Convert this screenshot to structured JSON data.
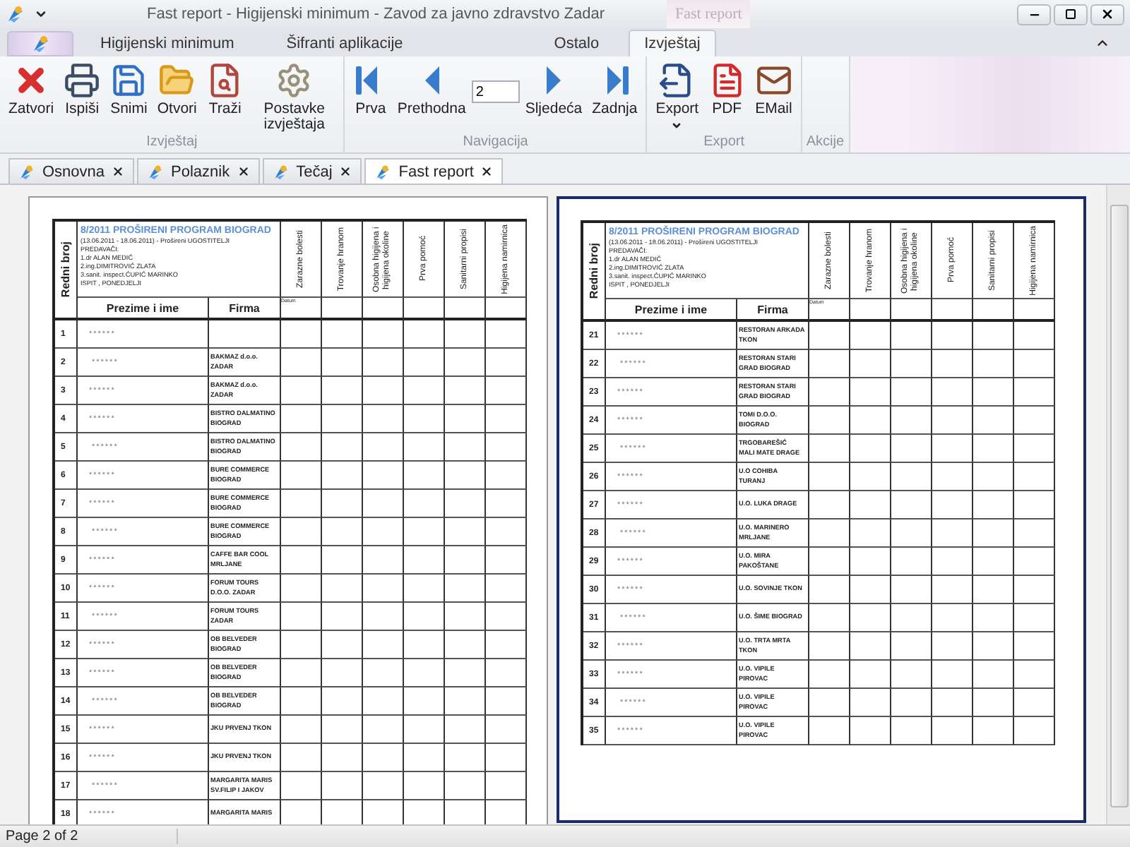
{
  "window": {
    "title": "Fast report - Higijenski minimum - Zavod za javno zdravstvo Zadar",
    "contextual_tab": "Fast report"
  },
  "ribbon": {
    "tabs": [
      {
        "label": "Higijenski minimum",
        "selected": false
      },
      {
        "label": "Šifranti aplikacije",
        "selected": false
      },
      {
        "label": "Ostalo",
        "selected": false
      },
      {
        "label": "Izvještaj",
        "selected": true
      }
    ],
    "groups": [
      {
        "label": "Izvještaj",
        "items": [
          {
            "kind": "close",
            "label": "Zatvori"
          },
          {
            "kind": "print",
            "label": "Ispiši"
          },
          {
            "kind": "save",
            "label": "Snimi"
          },
          {
            "kind": "open",
            "label": "Otvori"
          },
          {
            "kind": "find",
            "label": "Traži"
          },
          {
            "kind": "settings",
            "label": "Postavke izvještaja"
          }
        ]
      },
      {
        "label": "Navigacija",
        "items": [
          {
            "kind": "first",
            "label": "Prva"
          },
          {
            "kind": "previous",
            "label": "Prethodna"
          },
          {
            "kind": "page-field",
            "value": "2"
          },
          {
            "kind": "next",
            "label": "Sljedeća"
          },
          {
            "kind": "last",
            "label": "Zadnja"
          }
        ]
      },
      {
        "label": "Export",
        "items": [
          {
            "kind": "export",
            "label": "Export"
          },
          {
            "kind": "pdf",
            "label": "PDF"
          },
          {
            "kind": "email",
            "label": "EMail"
          }
        ]
      },
      {
        "label": "Akcije"
      }
    ]
  },
  "document_tabs": [
    {
      "label": "Osnovna",
      "selected": false
    },
    {
      "label": "Polaznik",
      "selected": false
    },
    {
      "label": "Tečaj",
      "selected": false
    },
    {
      "label": "Fast report",
      "selected": true
    }
  ],
  "pages": [
    {
      "selected": false,
      "header": {
        "index_header": "Redni broj",
        "title": "8/2011 PROŠIRENI PROGRAM BIOGRAD",
        "period": "(13.06.2011 - 18.06.2011) - Prošireni UGOSTITELJI",
        "lines": [
          "PREDAVAČI:",
          "1.dr ALAN MEDIĆ",
          "2.ing.DIMITROVIĆ ZLATA",
          "3.sanit. inspect.ĆUPIĆ MARINKO",
          "ISPIT , PONEDJELJI"
        ],
        "subjects": [
          "Zarazne bolesti",
          "Trovanje hranom",
          "Osobna higijena i higijena okoline",
          "Prva pomoć",
          "Sanitarni propisi",
          "Higijena namirnica"
        ],
        "name_header": "Prezime i ime",
        "firm_header": "Firma",
        "date_label": "Datum"
      },
      "rows": [
        {
          "number": "1",
          "name": "******",
          "firm": []
        },
        {
          "number": "2",
          "name": "******",
          "firm": [
            "BAKMAZ d.o.o.",
            "ZADAR"
          ]
        },
        {
          "number": "3",
          "name": "******",
          "firm": [
            "BAKMAZ d.o.o.",
            "ZADAR"
          ]
        },
        {
          "number": "4",
          "name": "******",
          "firm": [
            "BISTRO DALMATINO",
            "BIOGRAD"
          ]
        },
        {
          "number": "5",
          "name": "******",
          "firm": [
            "BISTRO DALMATINO",
            "BIOGRAD"
          ]
        },
        {
          "number": "6",
          "name": "******",
          "firm": [
            "BURE COMMERCE",
            "BIOGRAD"
          ]
        },
        {
          "number": "7",
          "name": "******",
          "firm": [
            "BURE COMMERCE",
            "BIOGRAD"
          ]
        },
        {
          "number": "8",
          "name": "******",
          "firm": [
            "BURE COMMERCE",
            "BIOGRAD"
          ]
        },
        {
          "number": "9",
          "name": "******",
          "firm": [
            "CAFFE BAR COOL",
            "MRLJANE"
          ]
        },
        {
          "number": "10",
          "name": "******",
          "firm": [
            "FORUM TOURS",
            "D.O.O. ZADAR"
          ]
        },
        {
          "number": "11",
          "name": "******",
          "firm": [
            "FORUM TOURS",
            "ZADAR"
          ]
        },
        {
          "number": "12",
          "name": "******",
          "firm": [
            "OB BELVEDER",
            "BIOGRAD"
          ]
        },
        {
          "number": "13",
          "name": "******",
          "firm": [
            "OB BELVEDER",
            "BIOGRAD"
          ]
        },
        {
          "number": "14",
          "name": "******",
          "firm": [
            "OB BELVEDER",
            "BIOGRAD"
          ]
        },
        {
          "number": "15",
          "name": "******",
          "firm": [
            "JKU PRVENJ TKON"
          ]
        },
        {
          "number": "16",
          "name": "******",
          "firm": [
            "JKU PRVENJ TKON"
          ]
        },
        {
          "number": "17",
          "name": "******",
          "firm": [
            "MARGARITA MARIS",
            "SV.FILIP I JAKOV"
          ]
        },
        {
          "number": "18",
          "name": "******",
          "firm": [
            "MARGARITA MARIS"
          ]
        }
      ]
    },
    {
      "selected": true,
      "header": {
        "index_header": "Redni broj",
        "title": "8/2011 PROŠIRENI PROGRAM BIOGRAD",
        "period": "(13.06.2011 - 18.06.2011) - Prošireni UGOSTITELJI",
        "lines": [
          "PREDAVAČI:",
          "1.dr ALAN MEDIĆ",
          "2.ing.DIMITROVIĆ ZLATA",
          "3.sanit. inspect.ĆUPIĆ MARINKO",
          "ISPIT , PONEDJELJI"
        ],
        "subjects": [
          "Zarazne bolesti",
          "Trovanje hranom",
          "Osobna higijena i higijena okoline",
          "Prva pomoć",
          "Sanitarni propisi",
          "Higijena namirnica"
        ],
        "name_header": "Prezime i ime",
        "firm_header": "Firma",
        "date_label": "Datum"
      },
      "rows": [
        {
          "number": "21",
          "name": "******",
          "firm": [
            "RESTORAN ARKADA",
            "TKON"
          ]
        },
        {
          "number": "22",
          "name": "******",
          "firm": [
            "RESTORAN STARI",
            "GRAD BIOGRAD"
          ]
        },
        {
          "number": "23",
          "name": "******",
          "firm": [
            "RESTORAN STARI",
            "GRAD BIOGRAD"
          ]
        },
        {
          "number": "24",
          "name": "******",
          "firm": [
            "TOMI D.O.O.",
            "BIOGRAD"
          ]
        },
        {
          "number": "25",
          "name": "******",
          "firm": [
            "TRGOBAREŠIĆ",
            "MALI MATE DRAGE"
          ]
        },
        {
          "number": "26",
          "name": "******",
          "firm": [
            "U.O COHIBA",
            "TURANJ"
          ]
        },
        {
          "number": "27",
          "name": "******",
          "firm": [
            "U.O. LUKA DRAGE"
          ]
        },
        {
          "number": "28",
          "name": "******",
          "firm": [
            "U.O. MARINERO",
            "MRLJANE"
          ]
        },
        {
          "number": "29",
          "name": "******",
          "firm": [
            "U.O. MIRA",
            "PAKOŠTANE"
          ]
        },
        {
          "number": "30",
          "name": "******",
          "firm": [
            "U.O. SOVINJE TKON"
          ]
        },
        {
          "number": "31",
          "name": "******",
          "firm": [
            "U.O. ŠIME BIOGRAD"
          ]
        },
        {
          "number": "32",
          "name": "******",
          "firm": [
            "U.O. TRTA MRTA",
            "TKON"
          ]
        },
        {
          "number": "33",
          "name": "******",
          "firm": [
            "U.O. VIPILE",
            "PIROVAC"
          ]
        },
        {
          "number": "34",
          "name": "******",
          "firm": [
            "U.O. VIPILE",
            "PIROVAC"
          ]
        },
        {
          "number": "35",
          "name": "******",
          "firm": [
            "U.O. VIPILE",
            "PIROVAC"
          ]
        }
      ]
    }
  ],
  "status_bar": "Page 2 of 2"
}
